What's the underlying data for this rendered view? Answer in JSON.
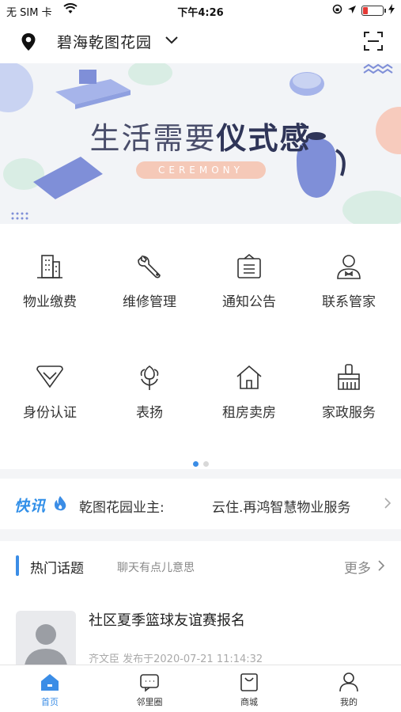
{
  "status_bar": {
    "carrier": "无 SIM 卡",
    "time": "下午4:26"
  },
  "header": {
    "community": "碧海乾图花园",
    "icons": [
      "location-pin-icon",
      "chevron-down-icon",
      "scan-icon"
    ]
  },
  "banner": {
    "slogan_plain": "生活需要",
    "slogan_bold": "仪式感",
    "tag": "CEREMONY"
  },
  "grid": {
    "items": [
      {
        "label": "物业缴费",
        "icon": "building-icon"
      },
      {
        "label": "维修管理",
        "icon": "wrench-icon"
      },
      {
        "label": "通知公告",
        "icon": "notice-board-icon"
      },
      {
        "label": "联系管家",
        "icon": "butler-icon"
      },
      {
        "label": "身份认证",
        "icon": "identity-badge-icon"
      },
      {
        "label": "表扬",
        "icon": "flower-icon"
      },
      {
        "label": "租房卖房",
        "icon": "house-icon"
      },
      {
        "label": "家政服务",
        "icon": "broom-icon"
      }
    ],
    "page_count": 2,
    "active_page": 1
  },
  "news": {
    "label": "快讯",
    "item1": "乾图花园业主:",
    "item2": "云住.再鸿智慧物业服务"
  },
  "topics": {
    "title": "热门话题",
    "subtitle": "聊天有点儿意思",
    "more": "更多",
    "post": {
      "title": "社区夏季篮球友谊赛报名",
      "meta": "齐文臣 发布于2020-07-21 11:14:32"
    }
  },
  "tabbar": {
    "tabs": [
      {
        "label": "首页",
        "icon": "home-icon",
        "active": true
      },
      {
        "label": "邻里圈",
        "icon": "chat-icon",
        "active": false
      },
      {
        "label": "商城",
        "icon": "shopping-bag-icon",
        "active": false
      },
      {
        "label": "我的",
        "icon": "user-icon",
        "active": false
      }
    ]
  },
  "colors": {
    "accent": "#3b8de6",
    "news_label": "#2f8ee8",
    "fire": "#3b8de6",
    "banner_tag": "#f5c9b8",
    "slogan": "#2f3558"
  }
}
